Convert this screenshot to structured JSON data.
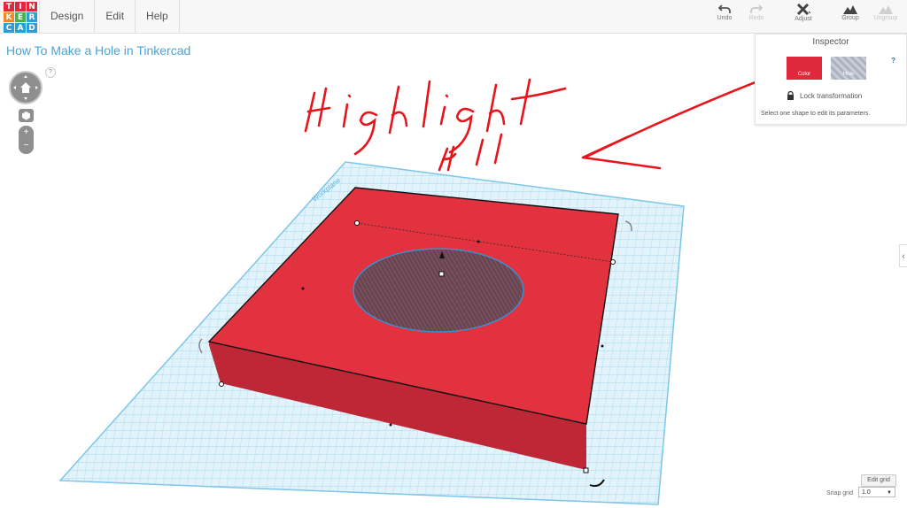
{
  "app": {
    "logo_letters": [
      "T",
      "I",
      "N",
      "K",
      "E",
      "R",
      "C",
      "A",
      "D"
    ],
    "logo_colors": [
      "#e0283c",
      "#e0283c",
      "#e0283c",
      "#f08a24",
      "#4caf50",
      "#2f9cd8",
      "#2f9cd8",
      "#2f9cd8",
      "#2f9cd8"
    ],
    "menu": [
      "Design",
      "Edit",
      "Help"
    ]
  },
  "toolbar": {
    "undo": "Undo",
    "redo": "Redo",
    "adjust": "Adjust",
    "group": "Group",
    "ungroup": "Ungroup"
  },
  "design_title": "How To Make a Hole in Tinkercad",
  "help_mark": "?",
  "inspector": {
    "title": "Inspector",
    "help": "?",
    "color_label": "Color",
    "hole_label": "Hole",
    "lock_label": "Lock transformation",
    "message": "Select one shape to edit its parameters."
  },
  "workplane": {
    "label": "Workplane"
  },
  "grid_controls": {
    "edit_grid": "Edit grid",
    "snap_label": "Snap grid",
    "snap_value": "1.0"
  },
  "annotation": {
    "text_line1": "Highlight",
    "text_line2": "All",
    "color": "#e8141b"
  },
  "colors": {
    "accent_blue": "#4aa3d6",
    "box_red": "#e2313f",
    "grid_blue": "#9fd3ec"
  }
}
